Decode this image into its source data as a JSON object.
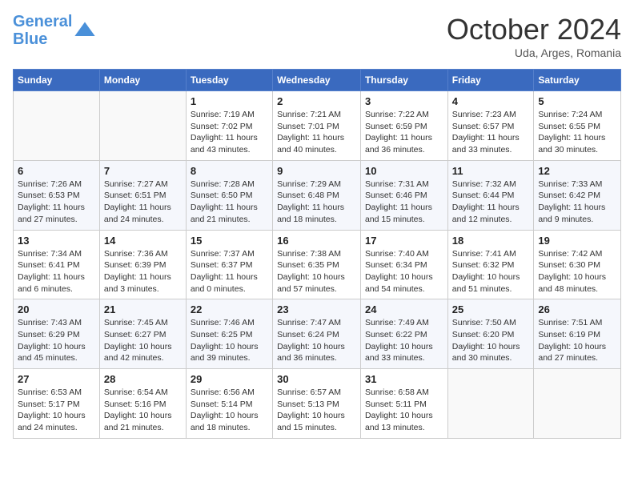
{
  "header": {
    "logo_line1": "General",
    "logo_line2": "Blue",
    "month": "October 2024",
    "location": "Uda, Arges, Romania"
  },
  "columns": [
    "Sunday",
    "Monday",
    "Tuesday",
    "Wednesday",
    "Thursday",
    "Friday",
    "Saturday"
  ],
  "rows": [
    [
      {
        "day": "",
        "detail": ""
      },
      {
        "day": "",
        "detail": ""
      },
      {
        "day": "1",
        "detail": "Sunrise: 7:19 AM\nSunset: 7:02 PM\nDaylight: 11 hours and 43 minutes."
      },
      {
        "day": "2",
        "detail": "Sunrise: 7:21 AM\nSunset: 7:01 PM\nDaylight: 11 hours and 40 minutes."
      },
      {
        "day": "3",
        "detail": "Sunrise: 7:22 AM\nSunset: 6:59 PM\nDaylight: 11 hours and 36 minutes."
      },
      {
        "day": "4",
        "detail": "Sunrise: 7:23 AM\nSunset: 6:57 PM\nDaylight: 11 hours and 33 minutes."
      },
      {
        "day": "5",
        "detail": "Sunrise: 7:24 AM\nSunset: 6:55 PM\nDaylight: 11 hours and 30 minutes."
      }
    ],
    [
      {
        "day": "6",
        "detail": "Sunrise: 7:26 AM\nSunset: 6:53 PM\nDaylight: 11 hours and 27 minutes."
      },
      {
        "day": "7",
        "detail": "Sunrise: 7:27 AM\nSunset: 6:51 PM\nDaylight: 11 hours and 24 minutes."
      },
      {
        "day": "8",
        "detail": "Sunrise: 7:28 AM\nSunset: 6:50 PM\nDaylight: 11 hours and 21 minutes."
      },
      {
        "day": "9",
        "detail": "Sunrise: 7:29 AM\nSunset: 6:48 PM\nDaylight: 11 hours and 18 minutes."
      },
      {
        "day": "10",
        "detail": "Sunrise: 7:31 AM\nSunset: 6:46 PM\nDaylight: 11 hours and 15 minutes."
      },
      {
        "day": "11",
        "detail": "Sunrise: 7:32 AM\nSunset: 6:44 PM\nDaylight: 11 hours and 12 minutes."
      },
      {
        "day": "12",
        "detail": "Sunrise: 7:33 AM\nSunset: 6:42 PM\nDaylight: 11 hours and 9 minutes."
      }
    ],
    [
      {
        "day": "13",
        "detail": "Sunrise: 7:34 AM\nSunset: 6:41 PM\nDaylight: 11 hours and 6 minutes."
      },
      {
        "day": "14",
        "detail": "Sunrise: 7:36 AM\nSunset: 6:39 PM\nDaylight: 11 hours and 3 minutes."
      },
      {
        "day": "15",
        "detail": "Sunrise: 7:37 AM\nSunset: 6:37 PM\nDaylight: 11 hours and 0 minutes."
      },
      {
        "day": "16",
        "detail": "Sunrise: 7:38 AM\nSunset: 6:35 PM\nDaylight: 10 hours and 57 minutes."
      },
      {
        "day": "17",
        "detail": "Sunrise: 7:40 AM\nSunset: 6:34 PM\nDaylight: 10 hours and 54 minutes."
      },
      {
        "day": "18",
        "detail": "Sunrise: 7:41 AM\nSunset: 6:32 PM\nDaylight: 10 hours and 51 minutes."
      },
      {
        "day": "19",
        "detail": "Sunrise: 7:42 AM\nSunset: 6:30 PM\nDaylight: 10 hours and 48 minutes."
      }
    ],
    [
      {
        "day": "20",
        "detail": "Sunrise: 7:43 AM\nSunset: 6:29 PM\nDaylight: 10 hours and 45 minutes."
      },
      {
        "day": "21",
        "detail": "Sunrise: 7:45 AM\nSunset: 6:27 PM\nDaylight: 10 hours and 42 minutes."
      },
      {
        "day": "22",
        "detail": "Sunrise: 7:46 AM\nSunset: 6:25 PM\nDaylight: 10 hours and 39 minutes."
      },
      {
        "day": "23",
        "detail": "Sunrise: 7:47 AM\nSunset: 6:24 PM\nDaylight: 10 hours and 36 minutes."
      },
      {
        "day": "24",
        "detail": "Sunrise: 7:49 AM\nSunset: 6:22 PM\nDaylight: 10 hours and 33 minutes."
      },
      {
        "day": "25",
        "detail": "Sunrise: 7:50 AM\nSunset: 6:20 PM\nDaylight: 10 hours and 30 minutes."
      },
      {
        "day": "26",
        "detail": "Sunrise: 7:51 AM\nSunset: 6:19 PM\nDaylight: 10 hours and 27 minutes."
      }
    ],
    [
      {
        "day": "27",
        "detail": "Sunrise: 6:53 AM\nSunset: 5:17 PM\nDaylight: 10 hours and 24 minutes."
      },
      {
        "day": "28",
        "detail": "Sunrise: 6:54 AM\nSunset: 5:16 PM\nDaylight: 10 hours and 21 minutes."
      },
      {
        "day": "29",
        "detail": "Sunrise: 6:56 AM\nSunset: 5:14 PM\nDaylight: 10 hours and 18 minutes."
      },
      {
        "day": "30",
        "detail": "Sunrise: 6:57 AM\nSunset: 5:13 PM\nDaylight: 10 hours and 15 minutes."
      },
      {
        "day": "31",
        "detail": "Sunrise: 6:58 AM\nSunset: 5:11 PM\nDaylight: 10 hours and 13 minutes."
      },
      {
        "day": "",
        "detail": ""
      },
      {
        "day": "",
        "detail": ""
      }
    ]
  ]
}
